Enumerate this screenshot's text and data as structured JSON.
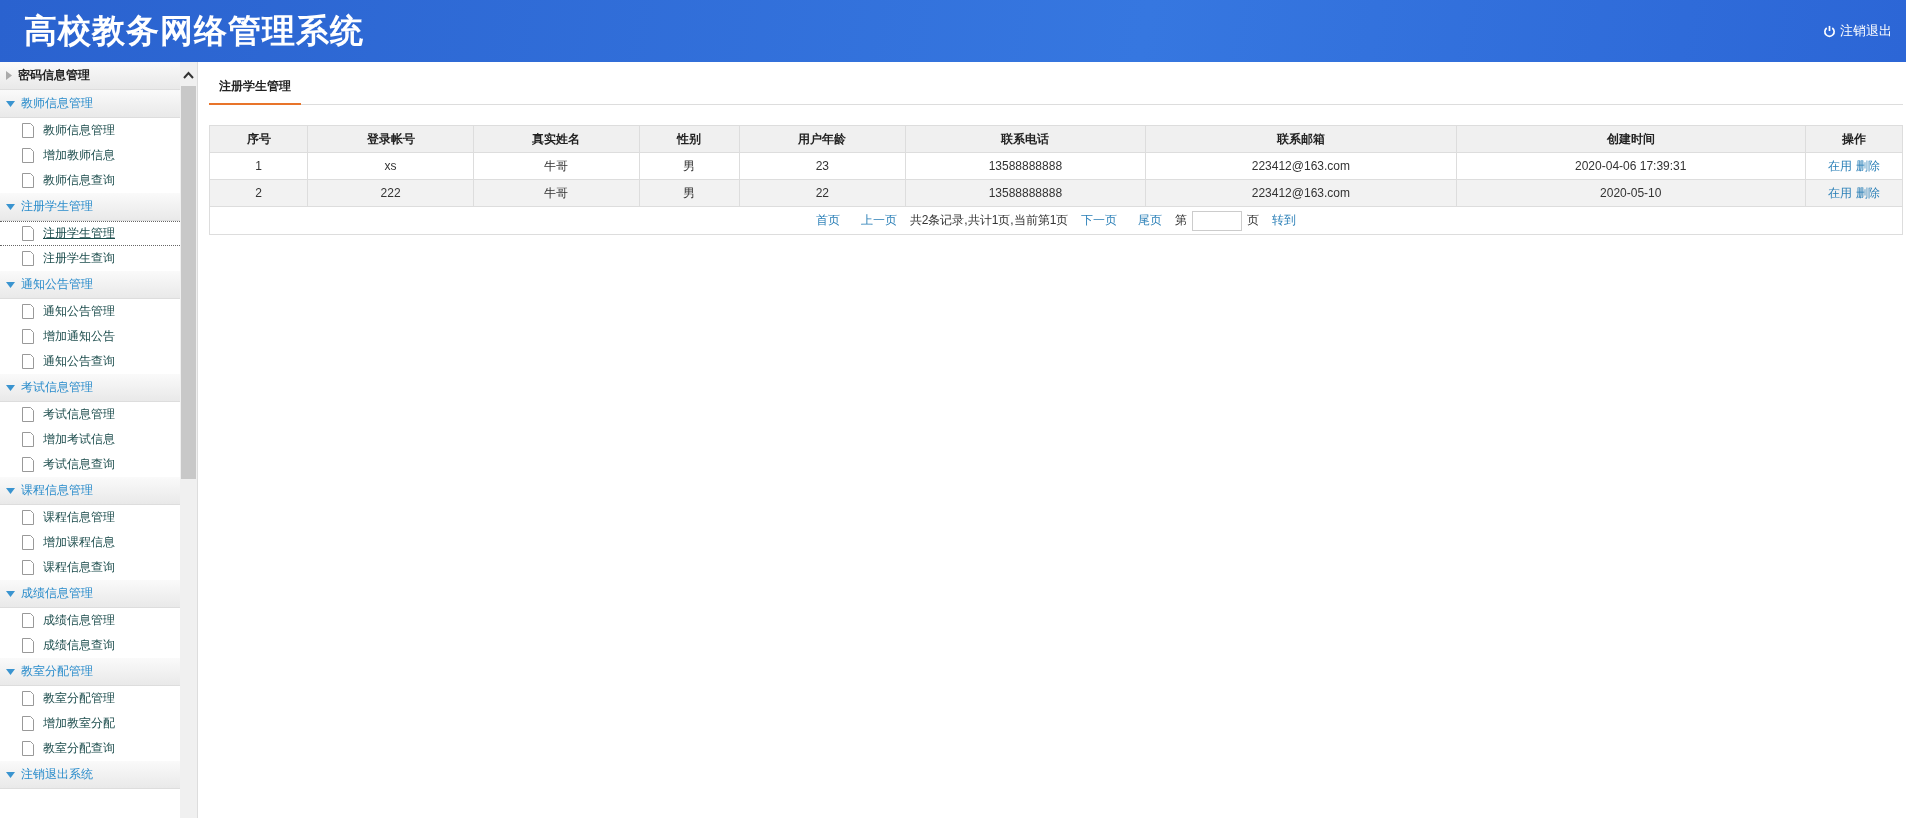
{
  "header": {
    "title": "高校教务网络管理系统",
    "logout": "注销退出"
  },
  "sidebar": {
    "groups": [
      {
        "label": "密码信息管理",
        "expanded": false
      },
      {
        "label": "教师信息管理",
        "expanded": true,
        "items": [
          {
            "label": "教师信息管理",
            "selected": false
          },
          {
            "label": "增加教师信息",
            "selected": false
          },
          {
            "label": "教师信息查询",
            "selected": false
          }
        ]
      },
      {
        "label": "注册学生管理",
        "expanded": true,
        "items": [
          {
            "label": "注册学生管理",
            "selected": true
          },
          {
            "label": "注册学生查询",
            "selected": false
          }
        ]
      },
      {
        "label": "通知公告管理",
        "expanded": true,
        "items": [
          {
            "label": "通知公告管理",
            "selected": false
          },
          {
            "label": "增加通知公告",
            "selected": false
          },
          {
            "label": "通知公告查询",
            "selected": false
          }
        ]
      },
      {
        "label": "考试信息管理",
        "expanded": true,
        "items": [
          {
            "label": "考试信息管理",
            "selected": false
          },
          {
            "label": "增加考试信息",
            "selected": false
          },
          {
            "label": "考试信息查询",
            "selected": false
          }
        ]
      },
      {
        "label": "课程信息管理",
        "expanded": true,
        "items": [
          {
            "label": "课程信息管理",
            "selected": false
          },
          {
            "label": "增加课程信息",
            "selected": false
          },
          {
            "label": "课程信息查询",
            "selected": false
          }
        ]
      },
      {
        "label": "成绩信息管理",
        "expanded": true,
        "items": [
          {
            "label": "成绩信息管理",
            "selected": false
          },
          {
            "label": "成绩信息查询",
            "selected": false
          }
        ]
      },
      {
        "label": "教室分配管理",
        "expanded": true,
        "items": [
          {
            "label": "教室分配管理",
            "selected": false
          },
          {
            "label": "增加教室分配",
            "selected": false
          },
          {
            "label": "教室分配查询",
            "selected": false
          }
        ]
      },
      {
        "label": "注销退出系统",
        "expanded": true
      }
    ]
  },
  "tabs": [
    {
      "label": "注册学生管理",
      "selected": true
    }
  ],
  "table": {
    "columns": [
      "序号",
      "登录帐号",
      "真实姓名",
      "性别",
      "用户年龄",
      "联系电话",
      "联系邮箱",
      "创建时间",
      "操作"
    ],
    "rows": [
      {
        "cells": [
          "1",
          "xs",
          "牛哥",
          "男",
          "23",
          "13588888888",
          "223412@163.com",
          "2020-04-06 17:39:31"
        ],
        "actions": [
          "在用",
          "删除"
        ]
      },
      {
        "cells": [
          "2",
          "222",
          "牛哥",
          "男",
          "22",
          "13588888888",
          "223412@163.com",
          "2020-05-10"
        ],
        "actions": [
          "在用",
          "删除"
        ]
      }
    ]
  },
  "pagination": [
    {
      "kind": "link",
      "text": "首页"
    },
    {
      "kind": "link",
      "text": "上一页"
    },
    {
      "kind": "text",
      "text": "共2条记录,共计1页,当前第1页"
    },
    {
      "kind": "link",
      "text": "下一页"
    },
    {
      "kind": "link",
      "text": "尾页"
    },
    {
      "kind": "text",
      "text": "第"
    },
    {
      "kind": "field"
    },
    {
      "kind": "text",
      "text": "页"
    },
    {
      "kind": "link",
      "text": "转到"
    }
  ]
}
